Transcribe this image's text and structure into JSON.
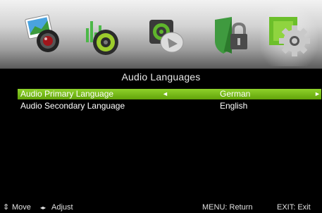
{
  "menu": {
    "icons": [
      {
        "name": "picture-icon"
      },
      {
        "name": "sound-icon"
      },
      {
        "name": "channel-icon"
      },
      {
        "name": "lock-icon"
      },
      {
        "name": "setup-icon",
        "active": true
      }
    ]
  },
  "screen": {
    "title": "Audio Languages",
    "rows": [
      {
        "label": "Audio Primary Language",
        "value": "German",
        "left_arrow": "◄",
        "right_arrow": "►"
      },
      {
        "label": "Audio Secondary Language",
        "value": "English"
      }
    ]
  },
  "footer": {
    "move_icon": "⇕",
    "move_label": "Move",
    "adjust_icon": "◂▸",
    "adjust_label": "Adjust",
    "menu_hint": "MENU: Return",
    "exit_hint": "EXIT: Exit"
  },
  "colors": {
    "selection": "#7fc11c",
    "background": "#000000"
  }
}
